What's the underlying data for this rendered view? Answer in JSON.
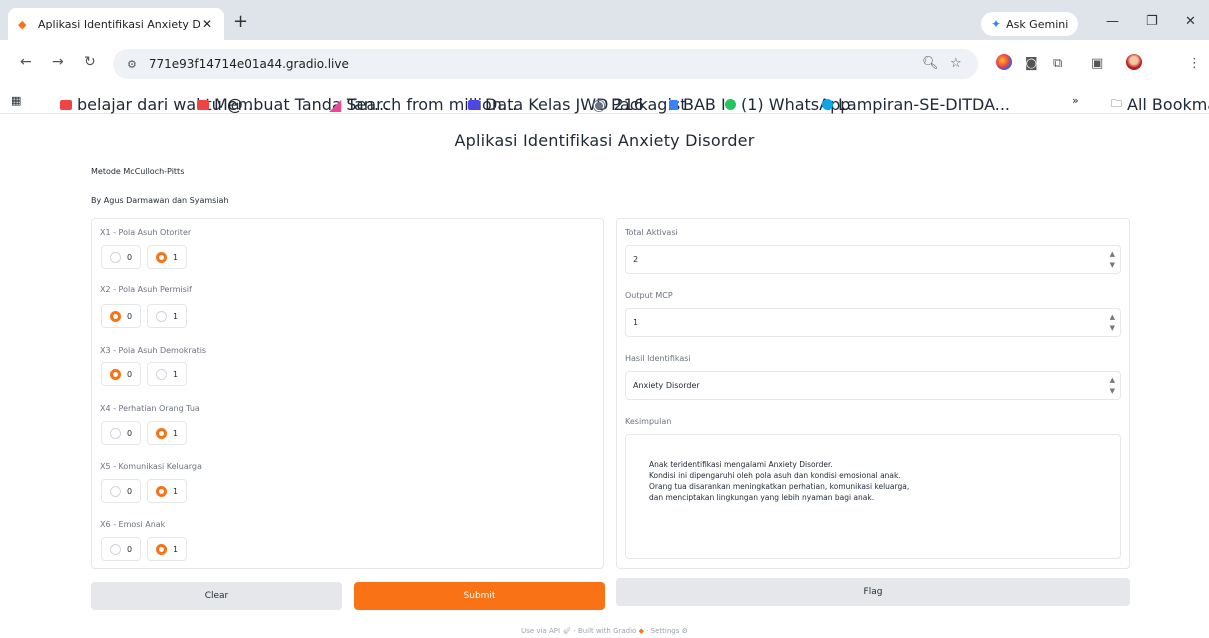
{
  "browser": {
    "tab_title": "Aplikasi Identifikasi Anxiety Dis",
    "new_tab": "+",
    "gemini_label": "Ask Gemini",
    "url": "771e93f14714e01a44.gradio.live",
    "bookmarks": [
      "belajar dari waktu @...",
      "Membuat Tanda Tan...",
      "Search from million...",
      "Data Kelas JWD 216",
      "Packagist",
      "BAB I",
      "(1) WhatsApp",
      "Lampiran-SE-DITDA..."
    ],
    "all_bookmarks": "All Bookmarks",
    "more_bookmarks": "»"
  },
  "app": {
    "title": "Aplikasi Identifikasi Anxiety Disorder",
    "method": "Metode McCulloch-Pitts",
    "author": "By Agus Darmawan dan Syamsiah"
  },
  "inputs": [
    {
      "label": "X1 - Pola Asuh Otoriter",
      "options": [
        "0",
        "1"
      ],
      "selected": "1"
    },
    {
      "label": "X2 - Pola Asuh Permisif",
      "options": [
        "0",
        "1"
      ],
      "selected": "0"
    },
    {
      "label": "X3 - Pola Asuh Demokratis",
      "options": [
        "0",
        "1"
      ],
      "selected": "0"
    },
    {
      "label": "X4 - Perhatian Orang Tua",
      "options": [
        "0",
        "1"
      ],
      "selected": "1"
    },
    {
      "label": "X5 - Komunikasi Keluarga",
      "options": [
        "0",
        "1"
      ],
      "selected": "1"
    },
    {
      "label": "X6 - Emosi Anak",
      "options": [
        "0",
        "1"
      ],
      "selected": "1"
    }
  ],
  "outputs": {
    "total_label": "Total Aktivasi",
    "total_value": "2",
    "mcp_label": "Output MCP",
    "mcp_value": "1",
    "hasil_label": "Hasil Identifikasi",
    "hasil_value": "Anxiety Disorder",
    "kesimpulan_label": "Kesimpulan",
    "kesimpulan_value": "Anak teridentifikasi mengalami Anxiety Disorder.\nKondisi ini dipengaruhi oleh pola asuh dan kondisi emosional anak.\nOrang tua disarankan meningkatkan perhatian, komunikasi keluarga,\ndan menciptakan lingkungan yang lebih nyaman bagi anak."
  },
  "buttons": {
    "clear": "Clear",
    "submit": "Submit",
    "flag": "Flag"
  },
  "footer": {
    "api": "Use via API",
    "built": "Built with Gradio",
    "settings": "Settings",
    "sep": "·"
  },
  "colors": {
    "accent": "#f97316",
    "secondary_button": "#e5e7eb",
    "border": "#e5e7eb"
  }
}
